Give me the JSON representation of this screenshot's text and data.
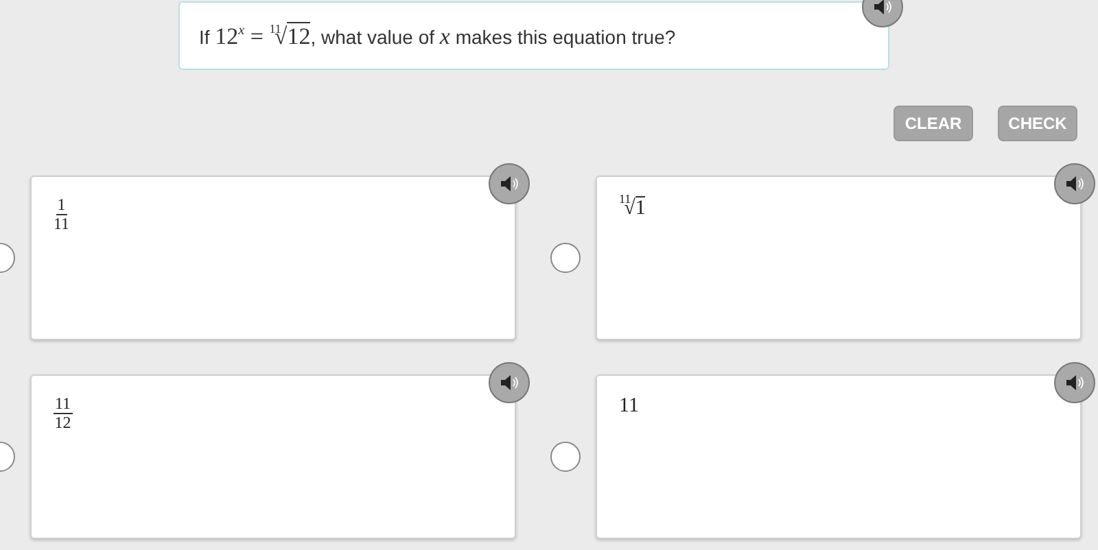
{
  "question": {
    "parts": [
      {
        "kind": "text",
        "text": "If "
      },
      {
        "kind": "power",
        "base": "12",
        "exponent": "x"
      },
      {
        "kind": "math",
        "text": " = "
      },
      {
        "kind": "root",
        "sign": "√",
        "index": "11",
        "radicand": "12"
      },
      {
        "kind": "text",
        "text": ", what value of "
      },
      {
        "kind": "var",
        "text": "x"
      },
      {
        "kind": "text",
        "text": " makes this equation true?"
      }
    ]
  },
  "buttons": [
    {
      "label": "CLEAR",
      "disabled": true
    },
    {
      "label": "CHECK",
      "disabled": true
    }
  ],
  "choices": [
    {
      "selected": false,
      "parts": [
        {
          "kind": "fraction",
          "numerator": "1",
          "denominator": "11"
        }
      ]
    },
    {
      "selected": false,
      "parts": [
        {
          "kind": "root",
          "sign": "√",
          "index": "11",
          "radicand": "1"
        }
      ]
    },
    {
      "selected": false,
      "parts": [
        {
          "kind": "fraction",
          "numerator": "11",
          "denominator": "12"
        }
      ]
    },
    {
      "selected": false,
      "parts": [
        {
          "kind": "math",
          "text": "11"
        }
      ]
    }
  ]
}
